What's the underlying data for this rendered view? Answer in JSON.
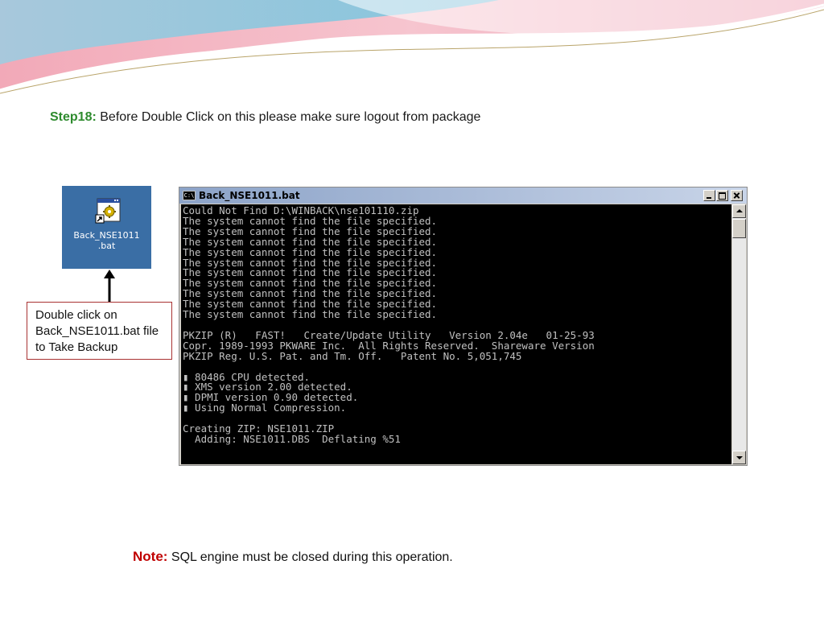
{
  "slide": {
    "step_label": "Step18:",
    "step_text": " Before Double Click on this please make sure logout from package",
    "note_label": "Note:",
    "note_text": " SQL engine must be closed during this operation.",
    "callout_text": "Double click on Back_NSE1011.bat file to Take Backup"
  },
  "desktop_icon": {
    "label_line1": "Back_NSE1011",
    "label_line2": ".bat",
    "icon": "batch-file-icon"
  },
  "console_window": {
    "title": "Back_NSE1011.bat",
    "icon_glyph": "C:\\",
    "lines": [
      "Could Not Find D:\\WINBACK\\nse101110.zip",
      "The system cannot find the file specified.",
      "The system cannot find the file specified.",
      "The system cannot find the file specified.",
      "The system cannot find the file specified.",
      "The system cannot find the file specified.",
      "The system cannot find the file specified.",
      "The system cannot find the file specified.",
      "The system cannot find the file specified.",
      "The system cannot find the file specified.",
      "The system cannot find the file specified.",
      "",
      "PKZIP (R)   FAST!   Create/Update Utility   Version 2.04e   01-25-93",
      "Copr. 1989-1993 PKWARE Inc.  All Rights Reserved.  Shareware Version",
      "PKZIP Reg. U.S. Pat. and Tm. Off.   Patent No. 5,051,745",
      "",
      "▮ 80486 CPU detected.",
      "▮ XMS version 2.00 detected.",
      "▮ DPMI version 0.90 detected.",
      "▮ Using Normal Compression.",
      "",
      "Creating ZIP: NSE1011.ZIP",
      "  Adding: NSE1011.DBS  Deflating %51"
    ]
  },
  "colors": {
    "step_label": "#2e8b2e",
    "note_label": "#c00000",
    "desktop_bg": "#3a6ea5",
    "console_bg": "#000000",
    "console_text": "#c0c0c0",
    "callout_border": "#a83232"
  }
}
